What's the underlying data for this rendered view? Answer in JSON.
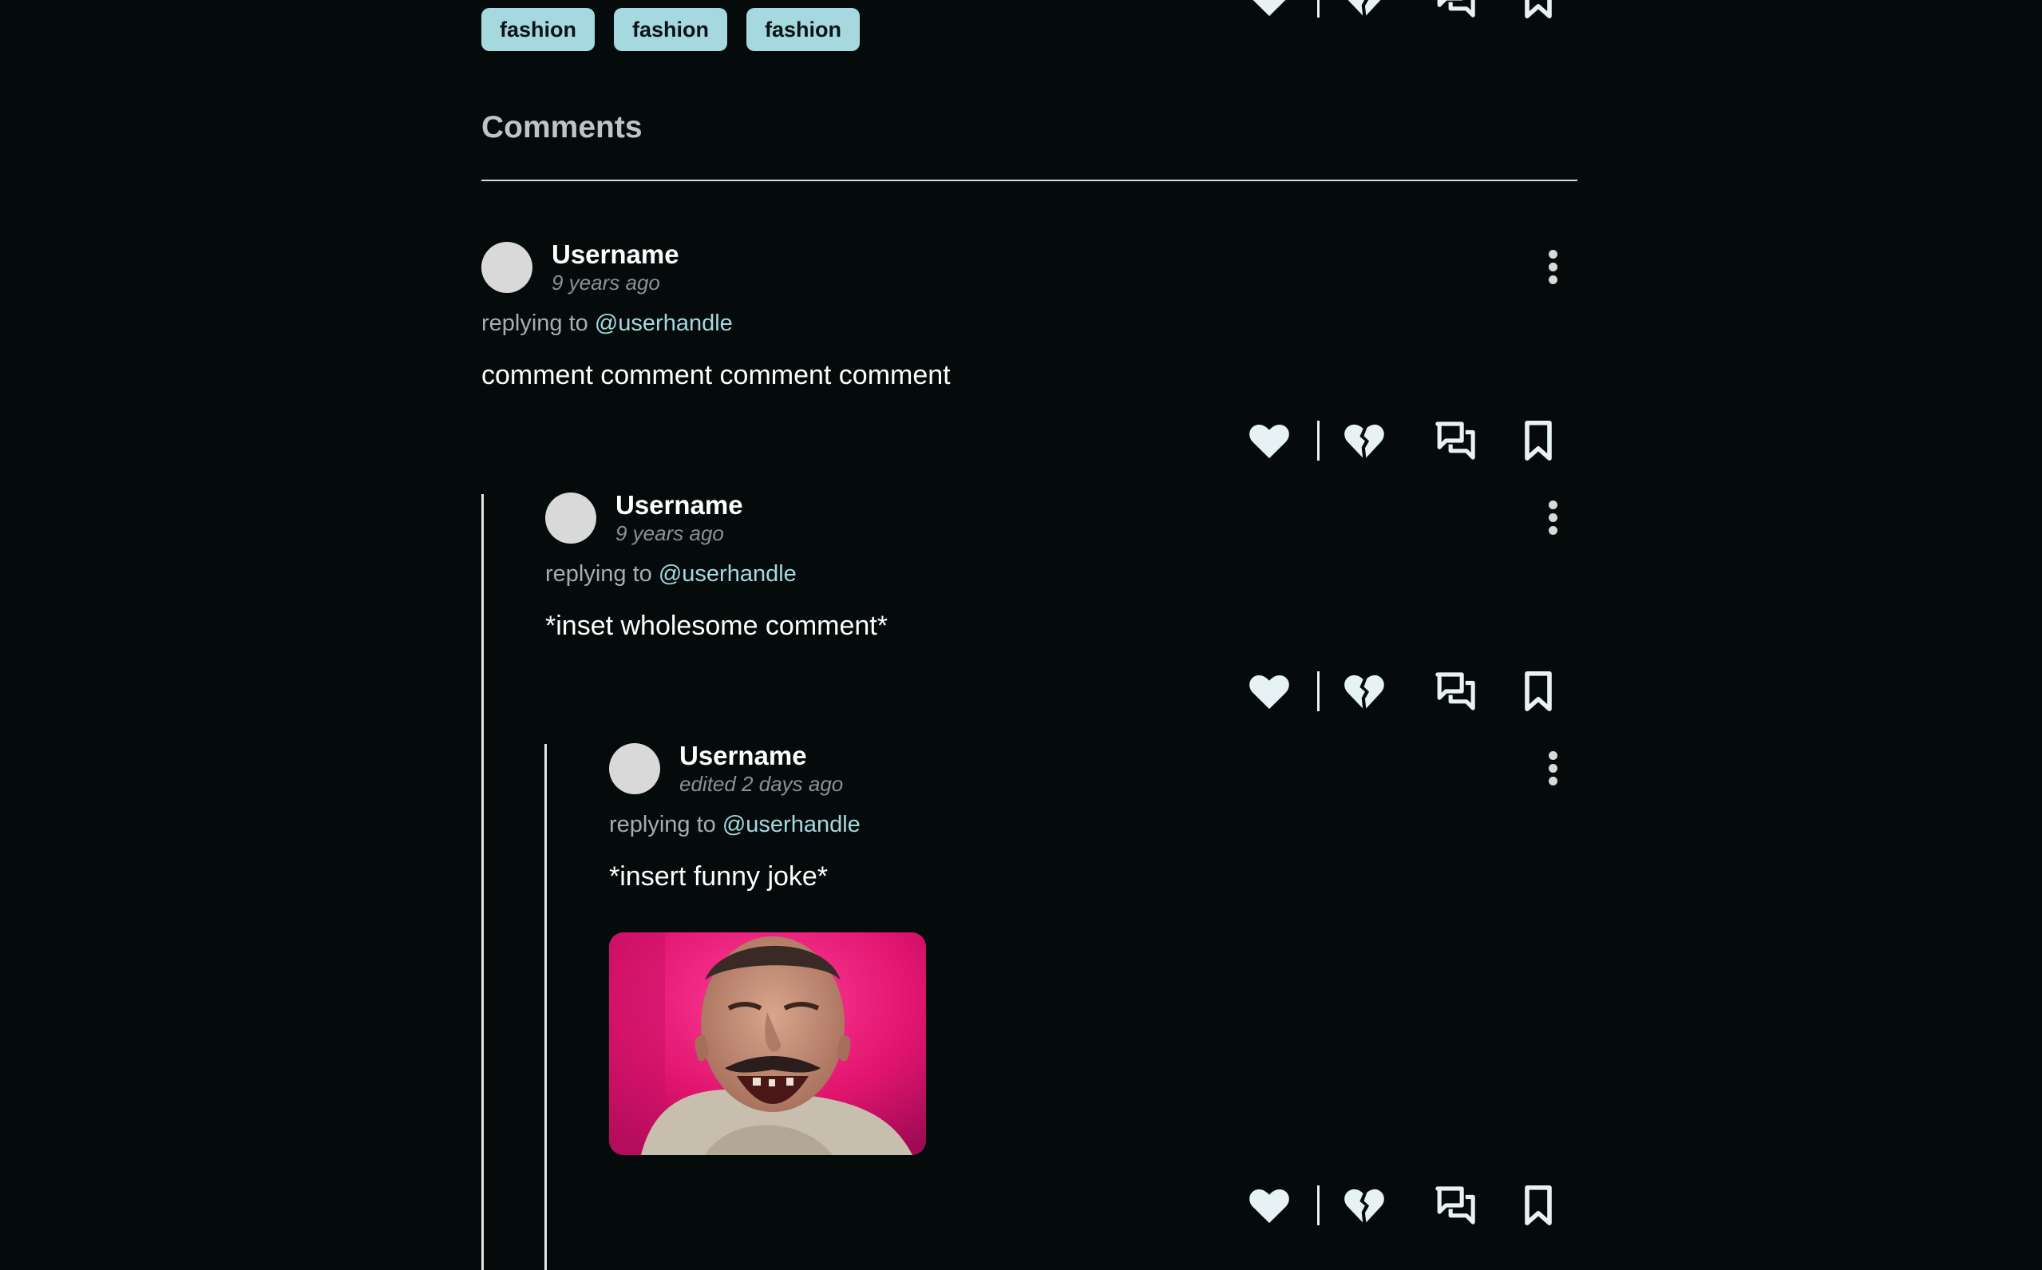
{
  "tags": [
    "fashion",
    "fashion",
    "fashion"
  ],
  "comments_section": {
    "title": "Comments"
  },
  "comments": [
    {
      "username": "Username",
      "timestamp": "9 years ago",
      "reply_prefix": "replying to ",
      "reply_handle": "@userhandle",
      "text": "comment comment comment comment"
    },
    {
      "username": "Username",
      "timestamp": "9 years ago",
      "reply_prefix": "replying to ",
      "reply_handle": "@userhandle",
      "text": "*inset wholesome comment*"
    },
    {
      "username": "Username",
      "timestamp": "edited 2 days ago",
      "reply_prefix": "replying to ",
      "reply_handle": "@userhandle",
      "text": "*insert funny joke*",
      "attachment": "laughing-man-image"
    }
  ],
  "actions": [
    "heart-icon",
    "broken-heart-icon",
    "reply-icon",
    "bookmark-icon"
  ],
  "colors": {
    "background": "#050a0b",
    "tag_bg": "#a6d8df",
    "accent": "#a6d8df",
    "icon": "#e6f2f4"
  }
}
